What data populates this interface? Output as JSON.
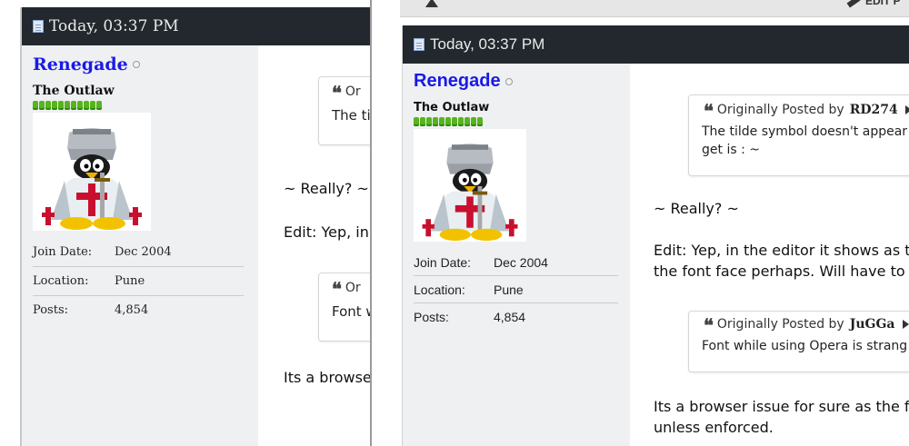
{
  "post": {
    "timestamp": "Today, 03:37 PM",
    "username": "Renegade",
    "user_title": "The Outlaw",
    "reputation_pips": 11,
    "fields": [
      {
        "key": "Join Date:",
        "value": "Dec 2004"
      },
      {
        "key": "Location:",
        "value": "Pune"
      },
      {
        "key": "Posts:",
        "value": "4,854"
      }
    ],
    "quote1": {
      "prefix": "Originally Posted by",
      "author": "RD274",
      "text_line1": "The tilde symbol doesn't appear",
      "text_line2": "get is : ~"
    },
    "line_really": "~ Really? ~",
    "line_edit1": "Edit: Yep, in the editor it shows as t",
    "line_edit2": "the font face perhaps. Will have to c",
    "quote2": {
      "prefix": "Originally Posted by",
      "author": "JuGGa",
      "text": "Font while using Opera is strang"
    },
    "line_browser1": "Its a browser issue for sure as the f",
    "line_browser2": "unless enforced."
  },
  "left_fragments": {
    "q1_prefix": "Or",
    "q1_text": "The tild",
    "really": "~ Really? ~",
    "edit": "Edit: Yep, in",
    "q2_prefix": "Or",
    "q2_text": "Font w",
    "browser": "Its a browse"
  },
  "top_toolbar": {
    "edit_label": "EDIT P"
  },
  "colors": {
    "header_bg": "#22282e",
    "username": "#1a1ae6",
    "reputation": "#57b41e",
    "sidebar_bg": "#eef0f2"
  }
}
